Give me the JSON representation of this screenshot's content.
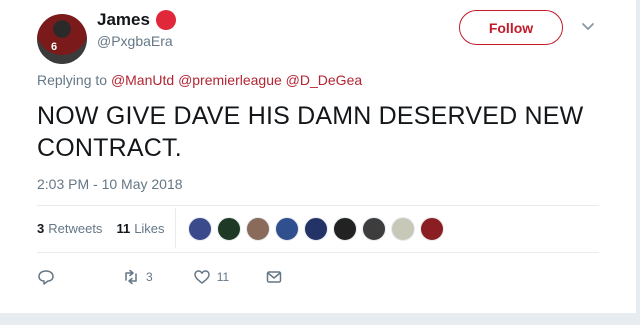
{
  "user": {
    "display_name": "James",
    "handle": "@PxgbaEra",
    "avatar_jersey_number": "6"
  },
  "follow_button": {
    "label": "Follow"
  },
  "replying": {
    "prefix": "Replying to",
    "mentions": [
      "@ManUtd",
      "@premierleague",
      "@D_DeGea"
    ]
  },
  "tweet": {
    "text": "NOW GIVE DAVE HIS DAMN DESERVED NEW CONTRACT.",
    "timestamp": "2:03 PM - 10 May 2018"
  },
  "stats": {
    "retweets_count": "3",
    "retweets_label": "Retweets",
    "likes_count": "11",
    "likes_label": "Likes"
  },
  "likers": [
    {
      "color": "#3a4a8a"
    },
    {
      "color": "#1e3a26"
    },
    {
      "color": "#8a6a5a"
    },
    {
      "color": "#2f4f8f"
    },
    {
      "color": "#243366"
    },
    {
      "color": "#222222"
    },
    {
      "color": "#3d3d3d"
    },
    {
      "color": "#c8c8b8"
    },
    {
      "color": "#8b1e22"
    }
  ],
  "actions": {
    "retweet_count": "3",
    "like_count": "11"
  },
  "colors": {
    "accent": "#c21b2a",
    "link": "#b32433",
    "muted": "#657786",
    "flair": "#e0283a"
  }
}
